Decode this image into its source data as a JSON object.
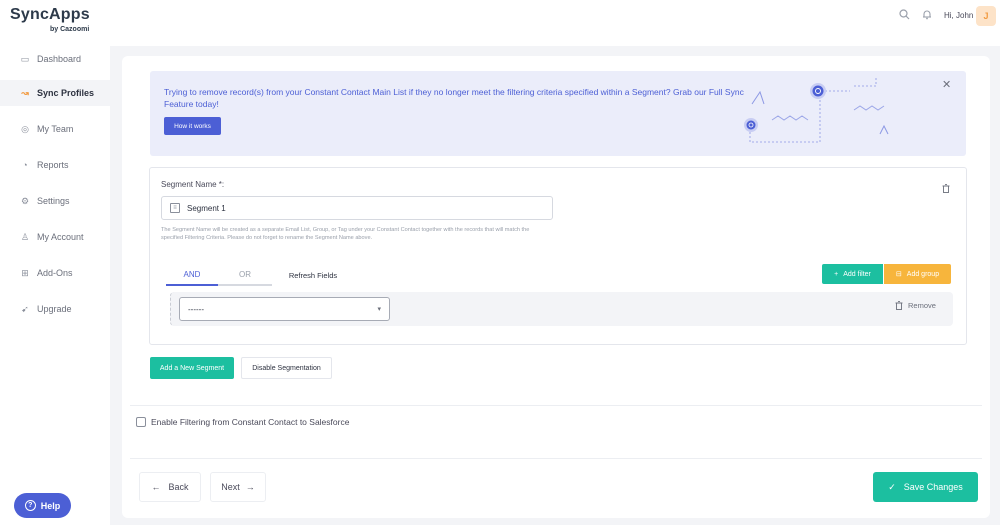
{
  "header": {
    "logo_text": "SyncApps",
    "logo_sub": "by Cazoomi",
    "icons": [
      "search-icon",
      "bell-icon"
    ],
    "greeting": "Hi, John",
    "avatar_letter": "J"
  },
  "sidebar": {
    "items": [
      {
        "label": "Dashboard",
        "icon": "dashboard-icon",
        "glyph": "▭",
        "active": false
      },
      {
        "label": "Sync Profiles",
        "icon": "sync-icon",
        "glyph": "↝",
        "active": true
      },
      {
        "label": "My Team",
        "icon": "team-icon",
        "glyph": "◎",
        "active": false
      },
      {
        "label": "Reports",
        "icon": "reports-icon",
        "glyph": "◔",
        "active": false
      },
      {
        "label": "Settings",
        "icon": "gear-icon",
        "glyph": "⚙",
        "active": false
      },
      {
        "label": "My Account",
        "icon": "user-icon",
        "glyph": "♙",
        "active": false
      },
      {
        "label": "Add-Ons",
        "icon": "addons-icon",
        "glyph": "⊞",
        "active": false
      },
      {
        "label": "Upgrade",
        "icon": "rocket-icon",
        "glyph": "➹",
        "active": false
      }
    ],
    "help_label": "Help"
  },
  "banner": {
    "text": "Trying to remove record(s) from your Constant Contact Main List if they no longer meet the filtering criteria specified within a Segment? Grab our Full Sync Feature today!",
    "button_label": "How it works"
  },
  "segment": {
    "name_label": "Segment Name *:",
    "name_value": "Segment 1",
    "help_text": "The Segment Name will be created as a separate Email List, Group, or Tag under your Constant Contact together with the records that will match the specified Filtering Criteria. Please do not forget to rename the Segment Name above.",
    "tabs": {
      "and": "AND",
      "or": "OR",
      "refresh": "Refresh Fields"
    },
    "add_filter_label": "Add filter",
    "add_group_label": "Add group",
    "filter_select_value": "------",
    "remove_label": "Remove"
  },
  "actions": {
    "add_segment_label": "Add a New Segment",
    "disable_segmentation_label": "Disable Segmentation"
  },
  "filter_option": {
    "label": "Enable Filtering from Constant Contact to Salesforce",
    "checked": false
  },
  "footer": {
    "back_label": "Back",
    "next_label": "Next",
    "save_label": "Save Changes"
  },
  "colors": {
    "primary": "#4c5fd5",
    "teal": "#1cbfa0",
    "orange": "#f7b53c",
    "banner_bg": "#ebedfa"
  }
}
